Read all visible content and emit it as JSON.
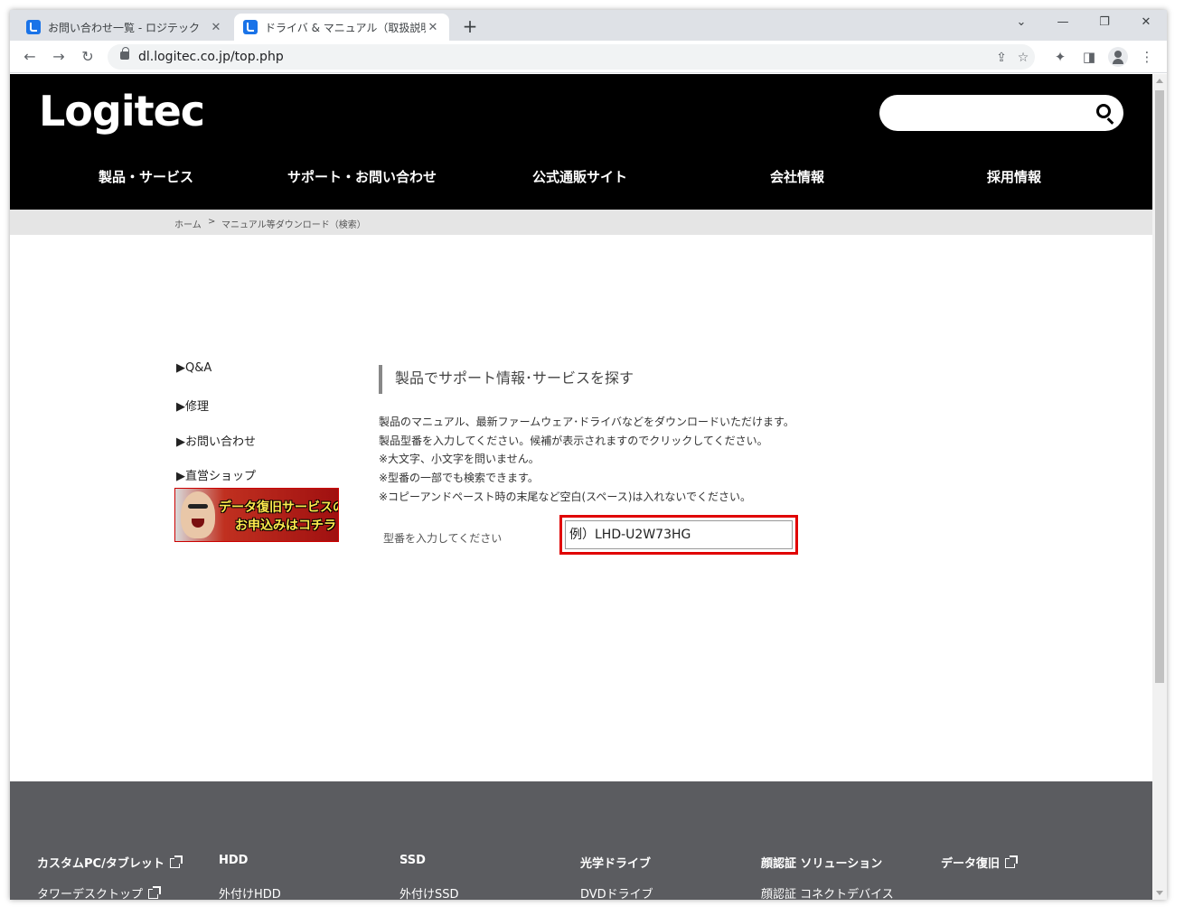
{
  "browser": {
    "tabs": [
      {
        "title": "お問い合わせ一覧 - ロジテック",
        "active": false
      },
      {
        "title": "ドライバ & マニュアル（取扱説明書）",
        "active": true
      }
    ],
    "new_tab_label": "+",
    "url": "dl.logitec.co.jp/top.php",
    "controls": {
      "dropdown": "⌄",
      "minimize": "—",
      "restore": "❐",
      "close": "✕"
    },
    "nav": {
      "back": "←",
      "forward": "→",
      "reload": "↻"
    },
    "icons": {
      "share": "⇪",
      "star": "☆",
      "extensions": "✦",
      "sidepanel": "◨",
      "menu": "⋮"
    }
  },
  "site": {
    "logo": "Logitec",
    "search_placeholder": "",
    "nav": [
      "製品・サービス",
      "サポート・お問い合わせ",
      "公式通販サイト",
      "会社情報",
      "採用情報"
    ],
    "breadcrumb": [
      "ホーム",
      ">",
      "マニュアル等ダウンロード（検索）"
    ]
  },
  "sidebar": {
    "links": [
      "▶Q&A",
      "▶修理",
      "▶お問い合わせ",
      "▶直営ショップ"
    ],
    "banner": {
      "line1": "データ復旧サービスの",
      "line2": "お申込みはコチラ"
    }
  },
  "main": {
    "title": "製品でサポート情報･サービスを探す",
    "description": [
      "製品のマニュアル、最新ファームウェア･ドライバなどをダウンロードいただけます。",
      "製品型番を入力してください。候補が表示されますのでクリックしてください。",
      "※大文字、小文字を問いません。",
      "※型番の一部でも検索できます。",
      "※コピーアンドペースト時の末尾など空白(スペース)は入れないでください。"
    ],
    "model_label": "型番を入力してください",
    "model_placeholder": "例）LHD-U2W73HG",
    "model_value": ""
  },
  "footer": {
    "columns": [
      {
        "head": "カスタムPC/タブレット",
        "sub": "タワーデスクトップ"
      },
      {
        "head": "HDD",
        "sub": "外付けHDD"
      },
      {
        "head": "SSD",
        "sub": "外付けSSD"
      },
      {
        "head": "光学ドライブ",
        "sub": "DVDドライブ"
      },
      {
        "head": "顔認証 ソリューション",
        "sub": "顔認証 コネクトデバイス"
      },
      {
        "head": "データ復旧",
        "sub": ""
      }
    ]
  }
}
